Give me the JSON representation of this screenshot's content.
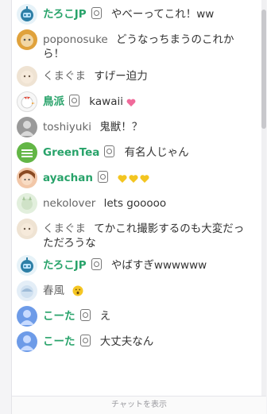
{
  "chat": {
    "messages": [
      {
        "name": "たろこJP",
        "member": true,
        "badge": true,
        "text": "やべーってこれ！ww",
        "avatar": "robot-avatar"
      },
      {
        "name": "poponosuke",
        "member": false,
        "badge": false,
        "text": "どうなっちまうのこれから！",
        "avatar": "user-avatar"
      },
      {
        "name": "くまぐま",
        "member": false,
        "badge": false,
        "text": "すげー迫力",
        "avatar": "user-avatar"
      },
      {
        "name": "鳥派",
        "member": true,
        "badge": true,
        "text": "kawaii",
        "avatar": "bird-avatar",
        "emoji": "sparkle-heart"
      },
      {
        "name": "toshiyuki",
        "member": false,
        "badge": false,
        "text": "鬼獣！？",
        "avatar": "user-avatar"
      },
      {
        "name": "GreenTea",
        "member": true,
        "badge": true,
        "text": "有名人じゃん",
        "avatar": "leaf-avatar"
      },
      {
        "name": "ayachan",
        "member": true,
        "badge": true,
        "text": "",
        "avatar": "girl-avatar",
        "emoji": "three-yellow-hearts"
      },
      {
        "name": "nekolover",
        "member": false,
        "badge": false,
        "text": "lets gooooo",
        "avatar": "cat-avatar"
      },
      {
        "name": "くまぐま",
        "member": false,
        "badge": false,
        "text": "てかこれ撮影するのも大変だっただろうな",
        "avatar": "user-avatar"
      },
      {
        "name": "たろこJP",
        "member": true,
        "badge": true,
        "text": "やばすぎwwwwww",
        "avatar": "robot-avatar"
      },
      {
        "name": "春風",
        "member": false,
        "badge": false,
        "text": "",
        "avatar": "blue-avatar",
        "emoji": "surprised-face"
      },
      {
        "name": "こーた",
        "member": true,
        "badge": true,
        "text": "え",
        "avatar": "person-avatar"
      },
      {
        "name": "こーた",
        "member": true,
        "badge": true,
        "text": "大丈夫なん",
        "avatar": "person-avatar"
      }
    ],
    "footer_text": "チャットを表示"
  },
  "colors": {
    "member_name": "#28a36a",
    "normal_name": "#666666"
  }
}
